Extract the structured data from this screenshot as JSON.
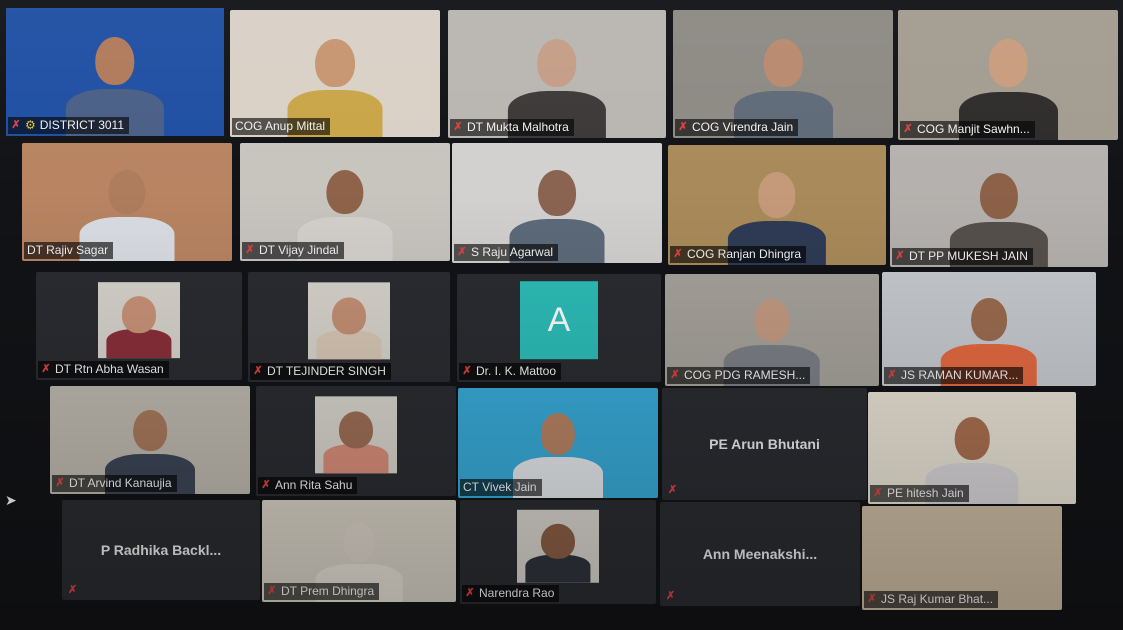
{
  "meeting": {
    "gallery": [
      {
        "name": "DISTRICT 3011",
        "kind": "video",
        "active": true,
        "muted": true,
        "icon": "rotary-wheel-icon",
        "bg": "#1f4fa3",
        "skin": "#b07a5a",
        "shirt": "#4a5f86"
      },
      {
        "name": "COG Anup Mittal",
        "kind": "video",
        "muted": false,
        "bg": "#d9d0c6",
        "skin": "#c79570",
        "shirt": "#c9a548"
      },
      {
        "name": "DT Mukta Malhotra",
        "kind": "video",
        "muted": true,
        "bg": "#b9b6b1",
        "skin": "#c49d86",
        "shirt": "#3c3838"
      },
      {
        "name": "COG Virendra Jain",
        "kind": "video",
        "muted": true,
        "bg": "#8d8a84",
        "skin": "#b88a6e",
        "shirt": "#5f6a78"
      },
      {
        "name": "COG Manjit Sawhn...",
        "kind": "video",
        "muted": true,
        "bg": "#a39c90",
        "skin": "#c99c7d",
        "shirt": "#2e2b2b"
      },
      {
        "name": "DT Rajiv Sagar",
        "kind": "video",
        "muted": false,
        "bg": "#b88462",
        "skin": "#ad7d5d",
        "shirt": "#d9dde3"
      },
      {
        "name": "DT Vijay Jindal",
        "kind": "video",
        "muted": true,
        "bg": "#c8c5bf",
        "skin": "#8e634a",
        "shirt": "#d4d1cd"
      },
      {
        "name": "S Raju Agarwal",
        "kind": "video",
        "muted": true,
        "bg": "#d2d1cf",
        "skin": "#8a6450",
        "shirt": "#5c6a7a"
      },
      {
        "name": "COG Ranjan Dhingra",
        "kind": "video",
        "muted": true,
        "bg": "#a98a5a",
        "skin": "#c59a7a",
        "shirt": "#2f3b55"
      },
      {
        "name": "DT PP MUKESH JAIN",
        "kind": "video",
        "muted": true,
        "bg": "#b5b1ae",
        "skin": "#8c6148",
        "shirt": "#55504c"
      },
      {
        "name": "DT Rtn Abha Wasan",
        "kind": "photo",
        "muted": true,
        "bg": "#2a2c31",
        "skin": "#c99278",
        "shirt": "#8a2f3a"
      },
      {
        "name": "DT TEJINDER SINGH",
        "kind": "photo",
        "muted": true,
        "bg": "#2a2c31",
        "skin": "#c49074",
        "shirt": "#d7c7b5"
      },
      {
        "name": "Dr. I. K. Mattoo",
        "kind": "avatar",
        "muted": true,
        "letter": "A"
      },
      {
        "name": "COG PDG RAMESH...",
        "kind": "video",
        "muted": true,
        "bg": "#a6a29b",
        "skin": "#c49a82",
        "shirt": "#7c7f87"
      },
      {
        "name": "JS RAMAN KUMAR...",
        "kind": "video",
        "muted": true,
        "bg": "#c7cbd0",
        "skin": "#9c6c50",
        "shirt": "#e56a42"
      },
      {
        "name": "DT Arvind Kanaujia",
        "kind": "video",
        "muted": true,
        "bg": "#bdb8ae",
        "skin": "#a7795c",
        "shirt": "#3c4556"
      },
      {
        "name": "Ann Rita Sahu",
        "kind": "photo",
        "muted": true,
        "bg": "#2a2c31",
        "skin": "#9d6e55",
        "shirt": "#d88d79"
      },
      {
        "name": "CT Vivek Jain",
        "kind": "video",
        "muted": false,
        "bg": "#38a9d6",
        "skin": "#b58262",
        "shirt": "#e3e6ea"
      },
      {
        "name": "PE Arun Bhutani",
        "kind": "name",
        "muted": true
      },
      {
        "name": "PE hitesh Jain",
        "kind": "video",
        "muted": true,
        "bg": "#e8e2d4",
        "skin": "#a86f50",
        "shirt": "#d7d4d7"
      },
      {
        "name": "P Radhika Backl...",
        "kind": "name",
        "muted": true
      },
      {
        "name": "DT Prem Dhingra",
        "kind": "video",
        "muted": true,
        "bg": "#d6d0c4",
        "skin": "#d9d2c8",
        "shirt": "#e3ddd2"
      },
      {
        "name": "Narendra Rao",
        "kind": "photo",
        "muted": true,
        "bg": "#2a2c31",
        "skin": "#8a5e44",
        "shirt": "#2f333c"
      },
      {
        "name": "Ann  Meenakshi...",
        "kind": "name",
        "muted": true
      },
      {
        "name": "JS Raj Kumar Bhat...",
        "kind": "video",
        "muted": true,
        "bg": "#cbbba2",
        "skin": "#cbbba2",
        "shirt": "#cbbba2"
      }
    ]
  },
  "colors": {
    "active_speaker_border": "#e9d33a",
    "muted_icon": "#e0413c",
    "tile_empty": "#2a2c31",
    "avatar_bg": "#2dbdb8"
  }
}
